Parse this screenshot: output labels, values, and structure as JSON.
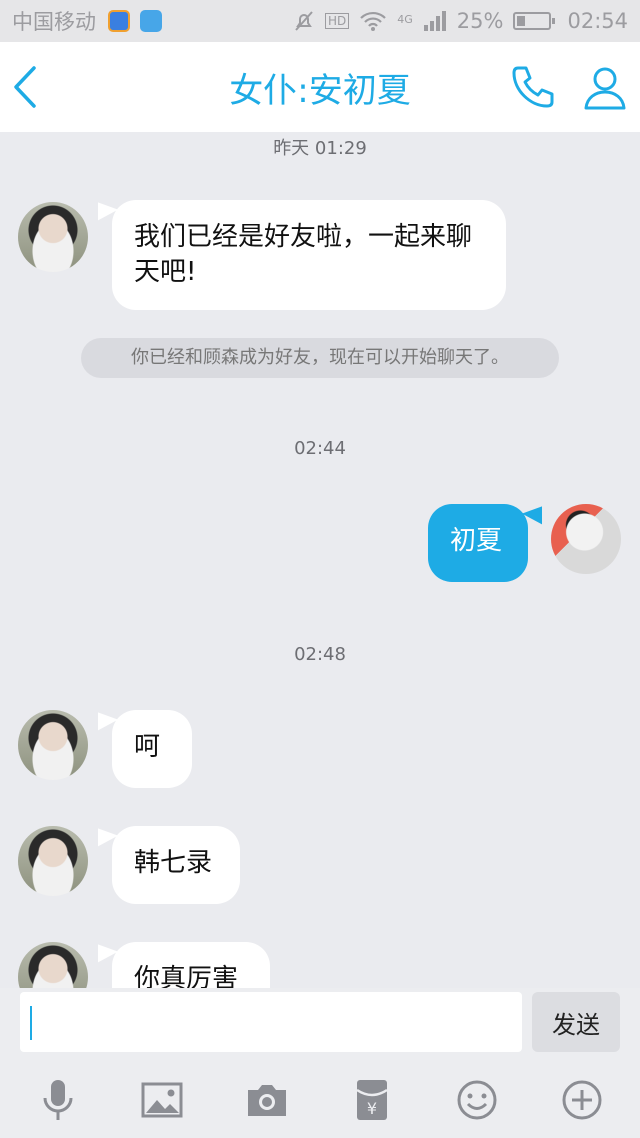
{
  "status_bar": {
    "carrier": "中国移动",
    "network": "4G",
    "hd": "HD",
    "battery_percent": "25%",
    "battery_level": 0.25,
    "time": "02:54"
  },
  "header": {
    "title": "女仆:安初夏"
  },
  "messages": {
    "ts1": "昨天 01:29",
    "m1": "我们已经是好友啦，一起来聊天吧!",
    "system_note": "你已经和顾森成为好友，现在可以开始聊天了。",
    "ts2": "02:44",
    "m2": "初夏",
    "ts3": "02:48",
    "m3": "呵",
    "m4": "韩七录",
    "m5": "你真厉害"
  },
  "input": {
    "value": "",
    "send_label": "发送"
  },
  "toolbar": {
    "icons": [
      "mic-icon",
      "image-icon",
      "camera-icon",
      "red-packet-icon",
      "emoji-icon",
      "plus-icon"
    ]
  },
  "colors": {
    "accent": "#1eabe5",
    "background": "#eaebef"
  }
}
